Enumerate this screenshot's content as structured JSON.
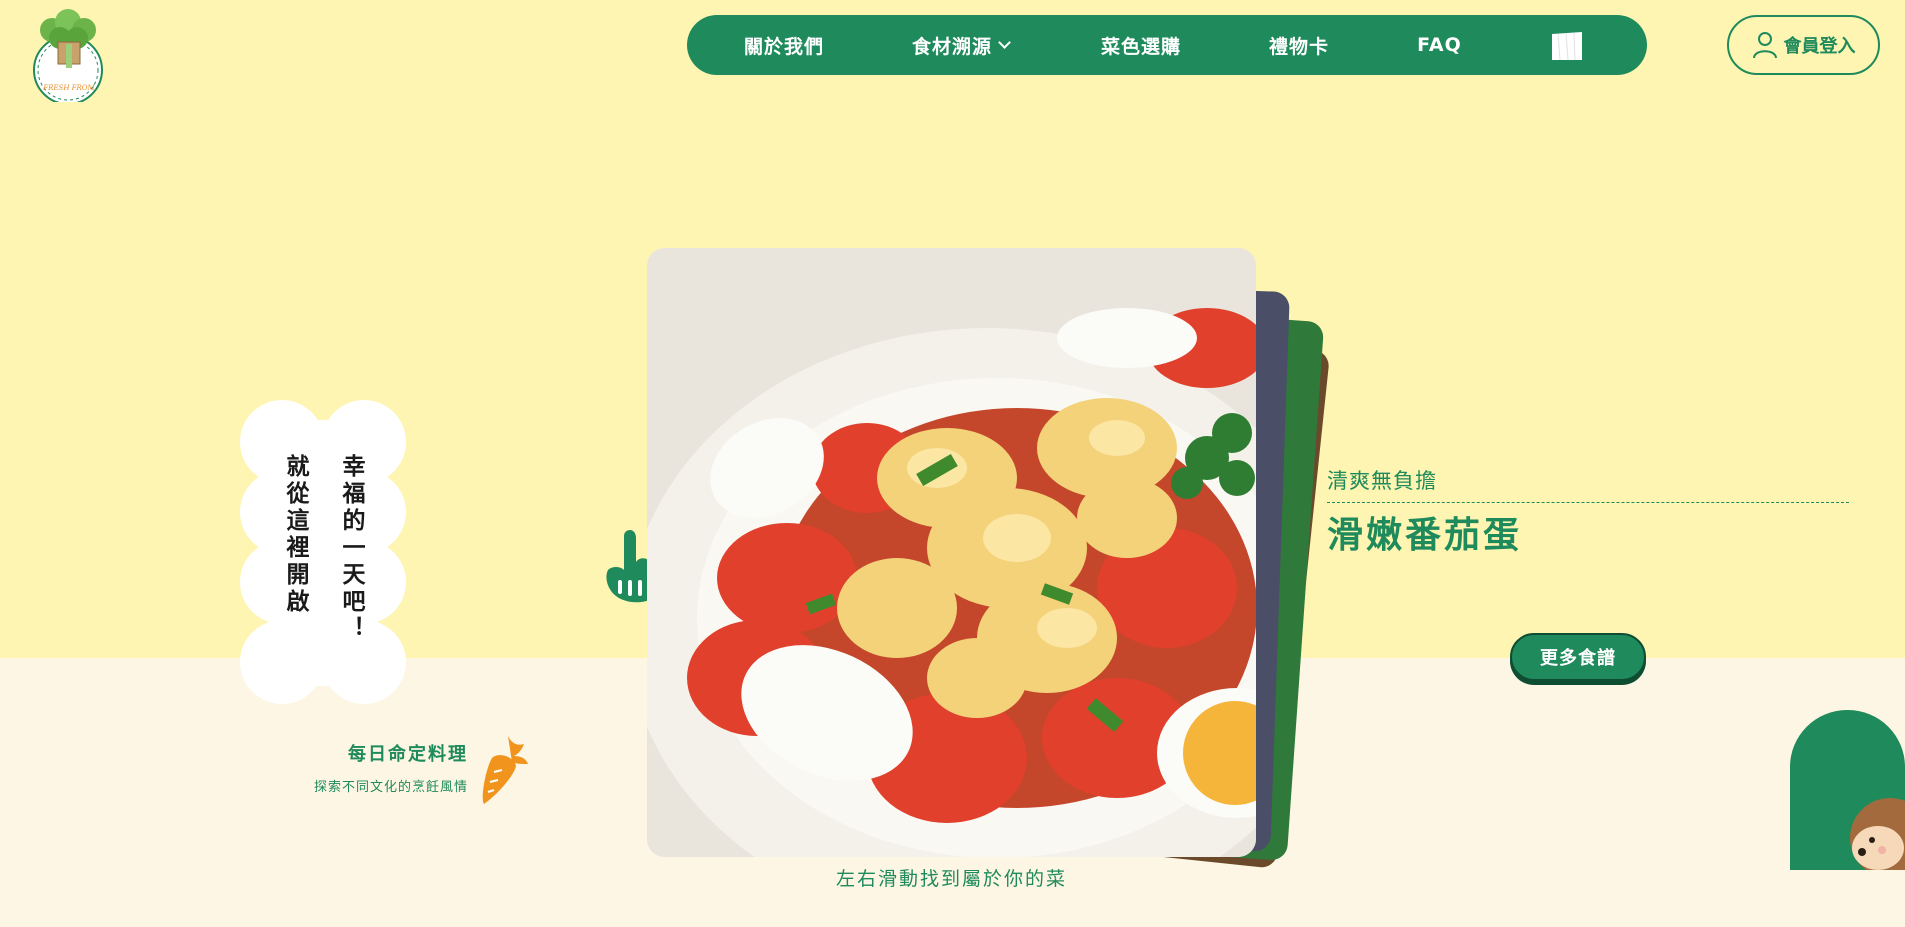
{
  "brand": {
    "logo_text": "FRESH FROM"
  },
  "nav": {
    "items": [
      {
        "label": "關於我們"
      },
      {
        "label": "食材溯源"
      },
      {
        "label": "菜色選購"
      },
      {
        "label": "禮物卡"
      },
      {
        "label": "FAQ"
      }
    ]
  },
  "login": {
    "label": "會員登入"
  },
  "hero": {
    "cloud_col1": "幸福的一天吧！",
    "cloud_col2": "就從這裡開啟"
  },
  "daily": {
    "title": "每日命定料理",
    "subtitle": "探索不同文化的烹飪風情"
  },
  "dish": {
    "subtitle": "清爽無負擔",
    "title": "滑嫩番茄蛋"
  },
  "more_button": {
    "label": "更多食譜"
  },
  "swipe_hint": "左右滑動找到屬於你的菜",
  "colors": {
    "brand_green": "#1f8a5b",
    "top_background": "#fdf5b1",
    "bottom_background": "#fdf6e4",
    "carrot_orange": "#f0941e"
  }
}
